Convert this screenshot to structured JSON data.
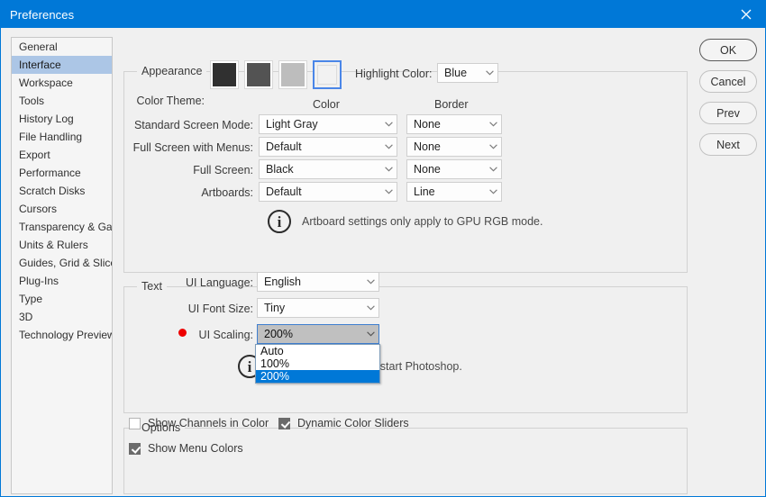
{
  "window": {
    "title": "Preferences",
    "close_icon": "close-icon",
    "accent_color": "#0078d7"
  },
  "sidebar": {
    "items": [
      {
        "label": "General",
        "selected": false
      },
      {
        "label": "Interface",
        "selected": true
      },
      {
        "label": "Workspace",
        "selected": false
      },
      {
        "label": "Tools",
        "selected": false
      },
      {
        "label": "History Log",
        "selected": false
      },
      {
        "label": "File Handling",
        "selected": false
      },
      {
        "label": "Export",
        "selected": false
      },
      {
        "label": "Performance",
        "selected": false
      },
      {
        "label": "Scratch Disks",
        "selected": false
      },
      {
        "label": "Cursors",
        "selected": false
      },
      {
        "label": "Transparency & Gamut",
        "selected": false
      },
      {
        "label": "Units & Rulers",
        "selected": false
      },
      {
        "label": "Guides, Grid & Slices",
        "selected": false
      },
      {
        "label": "Plug-Ins",
        "selected": false
      },
      {
        "label": "Type",
        "selected": false
      },
      {
        "label": "3D",
        "selected": false
      },
      {
        "label": "Technology Previews",
        "selected": false
      }
    ]
  },
  "appearance": {
    "group_title": "Appearance",
    "color_theme_label": "Color Theme:",
    "swatches": [
      {
        "name": "theme-darkest",
        "color": "#303030",
        "selected": false
      },
      {
        "name": "theme-dark",
        "color": "#535353",
        "selected": false
      },
      {
        "name": "theme-medium",
        "color": "#bdbdbd",
        "selected": false
      },
      {
        "name": "theme-light",
        "color": "#f2f2f2",
        "selected": true
      }
    ],
    "highlight_color_label": "Highlight Color:",
    "highlight_color_value": "Blue",
    "column_color": "Color",
    "column_border": "Border",
    "rows": [
      {
        "label": "Standard Screen Mode:",
        "color": "Light Gray",
        "border": "None"
      },
      {
        "label": "Full Screen with Menus:",
        "color": "Default",
        "border": "None"
      },
      {
        "label": "Full Screen:",
        "color": "Black",
        "border": "None"
      },
      {
        "label": "Artboards:",
        "color": "Default",
        "border": "Line"
      }
    ],
    "info_icon": "info-icon",
    "info_text": "Artboard settings only apply to GPU RGB mode."
  },
  "text_section": {
    "group_title": "Text",
    "ui_language_label": "UI Language:",
    "ui_language_value": "English",
    "ui_font_size_label": "UI Font Size:",
    "ui_font_size_value": "Tiny",
    "ui_scaling_label": "UI Scaling:",
    "ui_scaling_value": "200%",
    "ui_scaling_marker": "red-dot",
    "ui_scaling_options": [
      {
        "label": "Auto",
        "selected": false
      },
      {
        "label": "100%",
        "selected": false
      },
      {
        "label": "200%",
        "selected": true
      }
    ],
    "info_icon": "info-icon",
    "info_text": "ect the next time you start Photoshop."
  },
  "options": {
    "group_title": "Options",
    "checkboxes": [
      {
        "label": "Show Channels in Color",
        "checked": false
      },
      {
        "label": "Dynamic Color Sliders",
        "checked": true
      },
      {
        "label": "Show Menu Colors",
        "checked": true
      }
    ]
  },
  "buttons": [
    {
      "label": "OK",
      "default": true
    },
    {
      "label": "Cancel",
      "default": false
    },
    {
      "label": "Prev",
      "default": false
    },
    {
      "label": "Next",
      "default": false
    }
  ]
}
